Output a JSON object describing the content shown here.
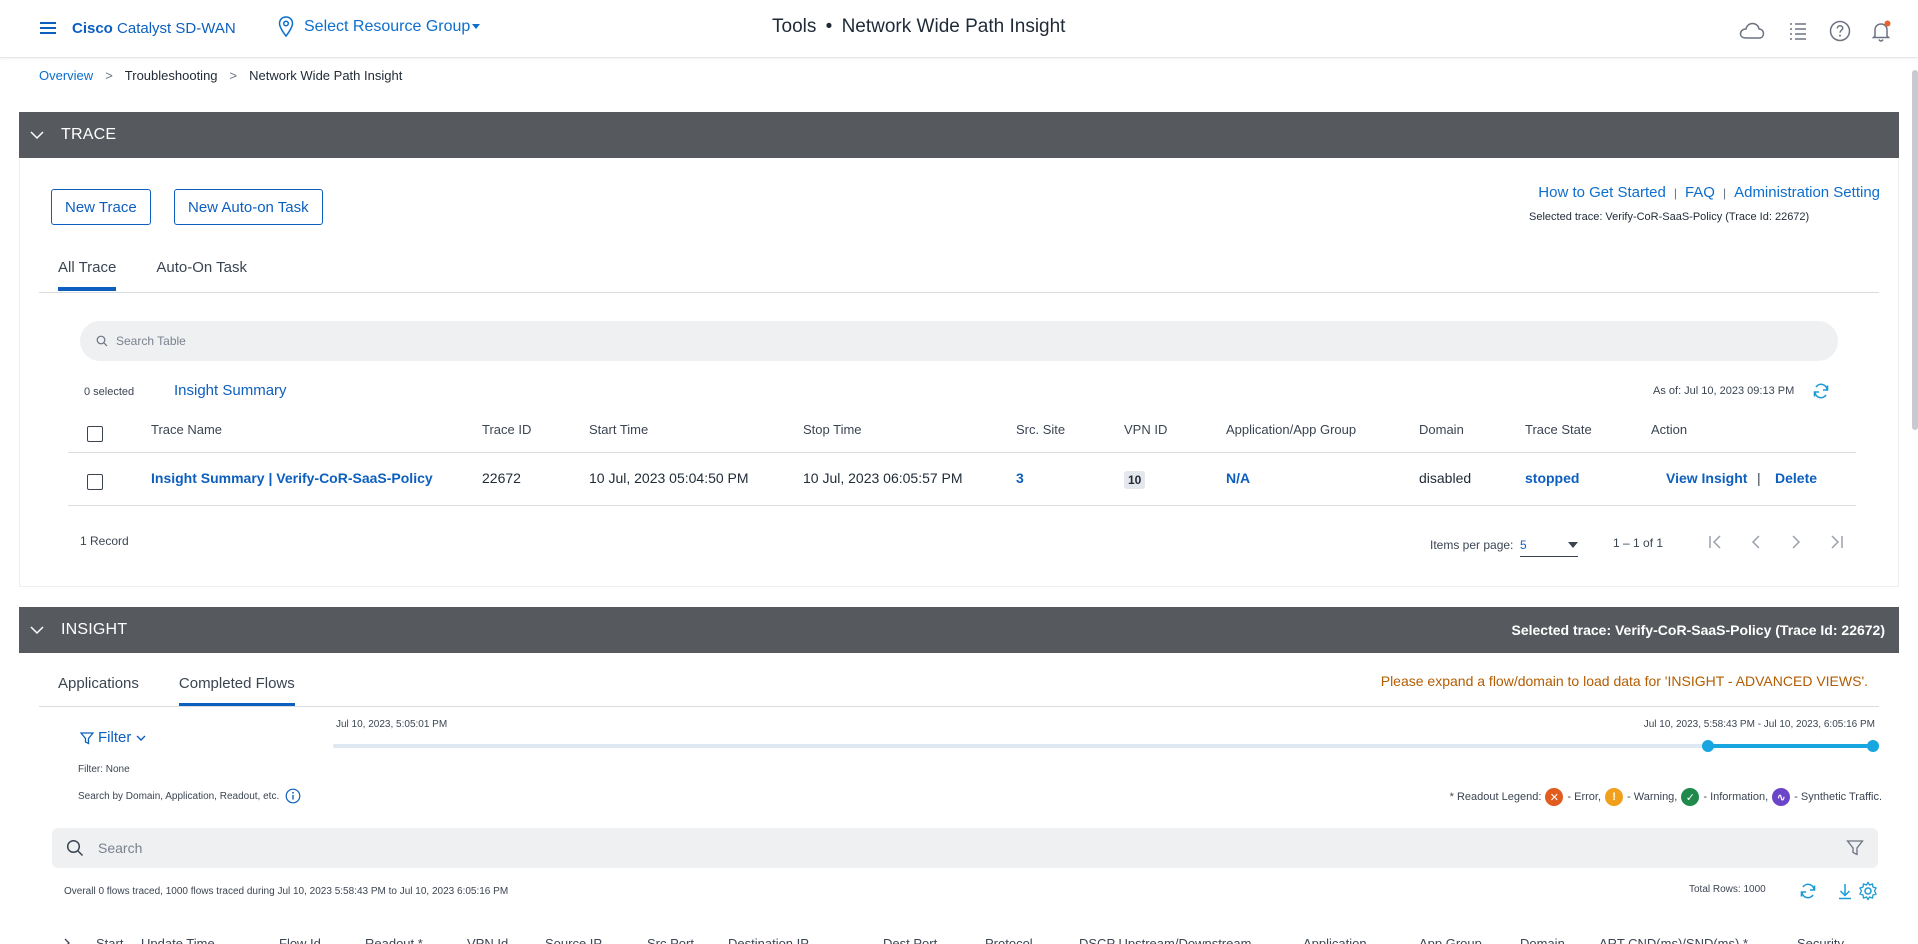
{
  "header": {
    "brand_bold": "Cisco",
    "brand_rest": "Catalyst SD-WAN",
    "resource_group": "Select Resource Group",
    "title_prefix": "Tools",
    "title_dot": "•",
    "title_main": "Network Wide Path Insight"
  },
  "breadcrumb": {
    "items": [
      "Overview",
      "Troubleshooting",
      "Network Wide Path Insight"
    ],
    "separator": ">"
  },
  "trace_section": {
    "title": "TRACE",
    "new_trace_label": "New Trace",
    "new_auto_task_label": "New Auto-on Task",
    "links": [
      "How to Get Started",
      "FAQ",
      "Administration Setting"
    ],
    "link_separator": "|",
    "selected_trace_small": "Selected trace: Verify-CoR-SaaS-Policy (Trace Id: 22672)",
    "tabs": [
      {
        "label": "All Trace",
        "active": true
      },
      {
        "label": "Auto-On Task",
        "active": false
      }
    ],
    "search_placeholder": "Search Table",
    "selected_count": "0 selected",
    "insight_summary_label": "Insight Summary",
    "as_of": "As of:  Jul 10, 2023 09:13 PM",
    "columns": [
      "Trace Name",
      "Trace ID",
      "Start Time",
      "Stop Time",
      "Src. Site",
      "VPN ID",
      "Application/App Group",
      "Domain",
      "Trace State",
      "Action"
    ],
    "rows": [
      {
        "trace_name": "Insight Summary | Verify-CoR-SaaS-Policy",
        "trace_id": "22672",
        "start_time": "10 Jul, 2023 05:04:50 PM",
        "stop_time": "10 Jul, 2023 06:05:57 PM",
        "src_site": "3",
        "vpn_id": "10",
        "app_group": "N/A",
        "domain": "disabled",
        "trace_state": "stopped",
        "action_view": "View Insight",
        "action_sep": "|",
        "action_delete": "Delete"
      }
    ],
    "record_count": "1 Record",
    "items_per_page_label": "Items per page:",
    "items_per_page_value": "5",
    "page_range": "1 – 1 of 1"
  },
  "insight_section": {
    "title": "INSIGHT",
    "selected_trace": "Selected trace: Verify-CoR-SaaS-Policy (Trace Id: 22672)",
    "tabs": [
      {
        "label": "Applications",
        "active": false
      },
      {
        "label": "Completed Flows",
        "active": true
      }
    ],
    "expand_notice": "Please expand a flow/domain to load data for 'INSIGHT - ADVANCED VIEWS'.",
    "filter_label": "Filter",
    "filter_state": "Filter: None",
    "search_hint": "Search by Domain, Application, Readout, etc.",
    "timeline_start": "Jul 10, 2023, 5:05:01 PM",
    "timeline_range": "Jul 10, 2023, 5:58:43 PM - Jul 10, 2023, 6:05:16 PM",
    "timeline_selection": {
      "start_fraction": 0.893,
      "end_fraction": 1.0
    },
    "legend_label": "* Readout Legend:",
    "legend_items": [
      {
        "symbol": "✕",
        "text": "- Error,",
        "color": "#e05c1f"
      },
      {
        "symbol": "!",
        "text": "- Warning,",
        "color": "#f0a01c"
      },
      {
        "symbol": "✓",
        "text": "- Information,",
        "color": "#1f8a4c"
      },
      {
        "symbol": "∿",
        "text": "- Synthetic Traffic.",
        "color": "#6b45c9"
      }
    ],
    "search_placeholder": "Search",
    "overall_summary": "Overall 0 flows traced, 1000 flows traced during Jul 10, 2023 5:58:43 PM to Jul 10, 2023 6:05:16 PM",
    "total_rows": "Total Rows: 1000",
    "columns": [
      "Start",
      "Update Time",
      "Flow Id",
      "Readout *",
      "VPN Id",
      "Source IP",
      "Src Port",
      "Destination IP",
      "Dest Port",
      "Protocol",
      "DSCP Upstream/Downstream",
      "Application",
      "App Group",
      "Domain",
      "ART CND(ms)/SND(ms) *",
      "Security"
    ]
  },
  "colors": {
    "accent": "#0d5fbf",
    "section_bar": "#56595e",
    "notice": "#b35c00",
    "timeline": "#18a6e0",
    "bell_dot": "#e8632b"
  }
}
